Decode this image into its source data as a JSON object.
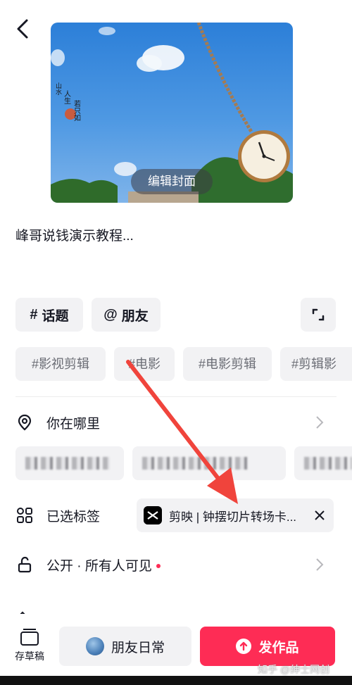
{
  "cover": {
    "edit_label": "编辑封面"
  },
  "caption": "峰哥说钱演示教程...",
  "chips": {
    "topic": "话题",
    "topic_symbol": "#",
    "friend": "朋友",
    "friend_symbol": "@"
  },
  "suggested_tags": [
    "#影视剪辑",
    "#电影",
    "#电影剪辑",
    "#剪辑影"
  ],
  "location": {
    "label": "你在哪里"
  },
  "selected_tag": {
    "label": "已选标签",
    "value": "剪映 | 钟摆切片转场卡..."
  },
  "visibility": {
    "label": "公开 · 所有人可见"
  },
  "bottom": {
    "drafts": "存草稿",
    "friends": "朋友日常",
    "publish": "发作品"
  },
  "watermark": "知乎 @绅士网创",
  "colors": {
    "accent": "#fe2c55",
    "chip_bg": "#f2f2f4",
    "arrow": "#f0443c"
  }
}
